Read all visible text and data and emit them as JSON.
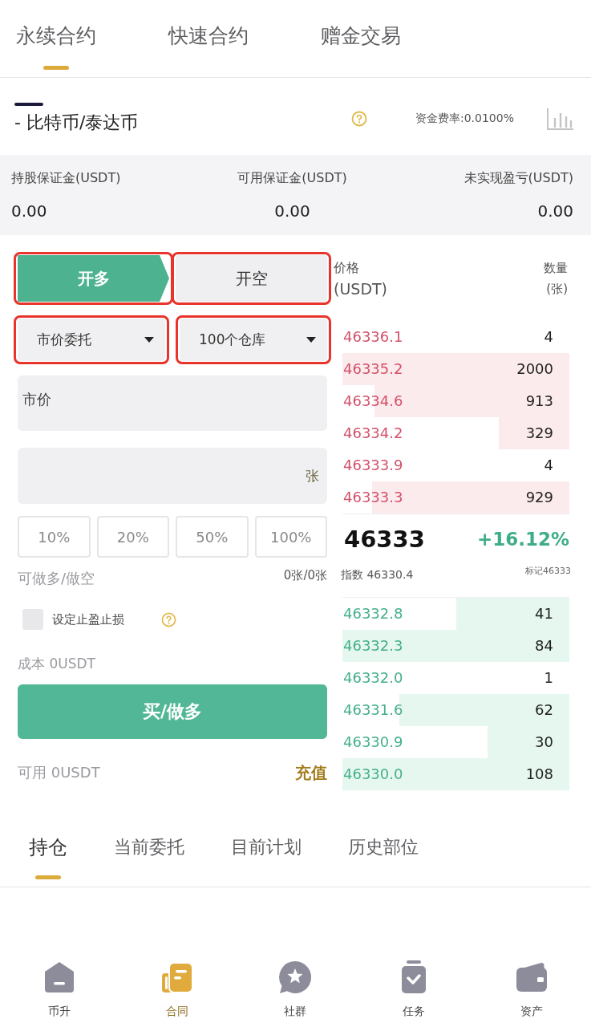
{
  "top_tabs": [
    {
      "label": "永续合约",
      "selected": true
    },
    {
      "label": "快速合约",
      "selected": false
    },
    {
      "label": "赠金交易",
      "selected": false
    }
  ],
  "pair": {
    "name": "- 比特币/泰达币",
    "funding_rate": "资金费率:0.0100%"
  },
  "margin_stats": [
    {
      "label": "持股保证金(USDT)",
      "value": "0.00"
    },
    {
      "label": "可用保证金(USDT)",
      "value": "0.00"
    },
    {
      "label": "未实现盈亏(USDT)",
      "value": "0.00"
    }
  ],
  "order_form": {
    "direction_tabs": [
      {
        "label": "开多",
        "selected": true,
        "highlighted": true
      },
      {
        "label": "开空",
        "selected": false,
        "highlighted": true
      }
    ],
    "selects": [
      {
        "value": "市价委托",
        "highlighted": true
      },
      {
        "value": "100个仓库",
        "highlighted": true
      }
    ],
    "price_field": {
      "value": "市价"
    },
    "amount_field": {
      "unit": "张"
    },
    "percent_buttons": [
      "10%",
      "20%",
      "50%",
      "100%"
    ],
    "max_open": {
      "label": "可做多/做空",
      "value": "0张/0张"
    },
    "take_profit": {
      "label": "设定止盈止损",
      "checked": false
    },
    "cost": "成本 0USDT",
    "submit": "买/做多",
    "available": "可用 0USDT",
    "deposit": "充值"
  },
  "order_book": {
    "price_header": "价格",
    "price_unit": "(USDT)",
    "qty_header": "数量",
    "qty_unit": "(张)",
    "asks": [
      {
        "price": "46336.1",
        "qty": "4"
      },
      {
        "price": "46335.2",
        "qty": "2000",
        "level": 1
      },
      {
        "price": "46334.6",
        "qty": "913",
        "level": 0.86
      },
      {
        "price": "46334.2",
        "qty": "329",
        "level": 0.31
      },
      {
        "price": "46333.9",
        "qty": "4"
      },
      {
        "price": "46333.3",
        "qty": "929",
        "level": 0.87
      }
    ],
    "last_price": "46333",
    "change": "+16.12%",
    "index_price": "指数 46330.4",
    "mark_price": "标记46333",
    "bids": [
      {
        "price": "46332.8",
        "qty": "41",
        "level": 0.5
      },
      {
        "price": "46332.3",
        "qty": "84",
        "level": 1
      },
      {
        "price": "46332.0",
        "qty": "1"
      },
      {
        "price": "46331.6",
        "qty": "62",
        "level": 0.75
      },
      {
        "price": "46330.9",
        "qty": "30",
        "level": 0.36
      },
      {
        "price": "46330.0",
        "qty": "108",
        "level": 1
      }
    ]
  },
  "position_tabs": [
    {
      "label": "持仓",
      "selected": true
    },
    {
      "label": "当前委托",
      "selected": false
    },
    {
      "label": "目前计划",
      "selected": false
    },
    {
      "label": "历史部位",
      "selected": false
    }
  ],
  "bottom_nav": [
    {
      "label": "币升",
      "kind": "home",
      "selected": false
    },
    {
      "label": "合同",
      "kind": "contract",
      "selected": true
    },
    {
      "label": "社群",
      "kind": "community",
      "selected": false
    },
    {
      "label": "任务",
      "kind": "task",
      "selected": false
    },
    {
      "label": "资产",
      "kind": "wallet",
      "selected": false
    }
  ]
}
